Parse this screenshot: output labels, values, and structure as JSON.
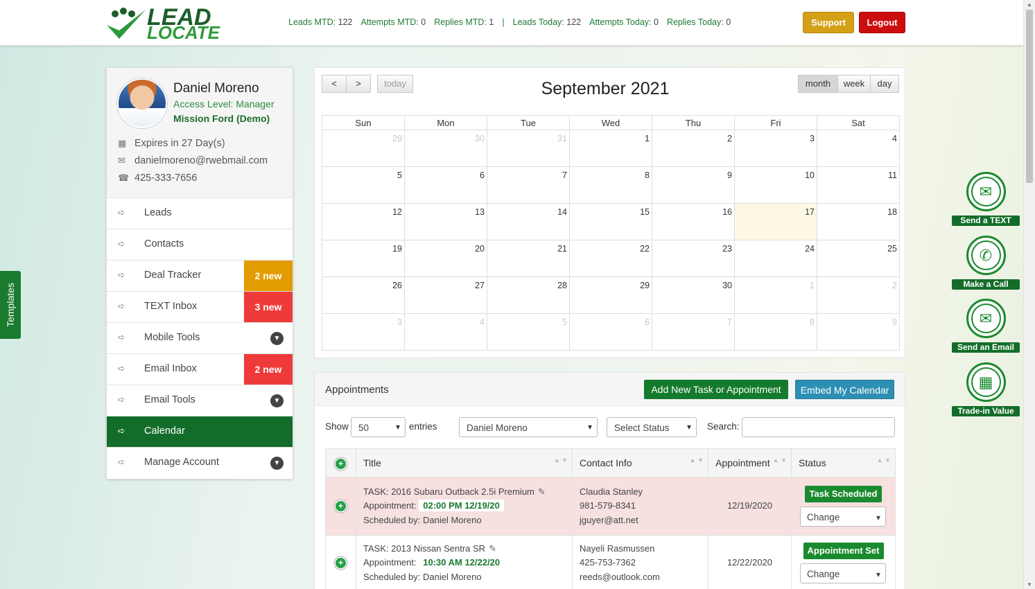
{
  "header": {
    "logo_line1": "LEAD",
    "logo_line2": "LOCATE",
    "stats": [
      {
        "label": "Leads MTD:",
        "value": "122"
      },
      {
        "label": "Attempts MTD:",
        "value": "0"
      },
      {
        "label": "Replies MTD:",
        "value": "1"
      },
      {
        "label": "|",
        "value": ""
      },
      {
        "label": "Leads Today:",
        "value": "122"
      },
      {
        "label": "Attempts Today:",
        "value": "0"
      },
      {
        "label": "Replies Today:",
        "value": "0"
      }
    ],
    "support_label": "Support",
    "logout_label": "Logout"
  },
  "templates_tab": "Templates",
  "profile": {
    "name": "Daniel Moreno",
    "access_level": "Access Level: Manager",
    "dealership": "Mission Ford (Demo)",
    "expires": "Expires in 27 Day(s)",
    "email": "danielmoreno@rwebmail.com",
    "phone": "425-333-7656"
  },
  "nav": [
    {
      "label": "Leads",
      "badge": "",
      "chevron": false,
      "active": false
    },
    {
      "label": "Contacts",
      "badge": "",
      "chevron": false,
      "active": false
    },
    {
      "label": "Deal Tracker",
      "badge": "2 new",
      "badge_color": "#e39c00",
      "chevron": false,
      "active": false
    },
    {
      "label": "TEXT Inbox",
      "badge": "3 new",
      "badge_color": "#ef3a3a",
      "chevron": false,
      "active": false
    },
    {
      "label": "Mobile Tools",
      "badge": "",
      "chevron": true,
      "active": false
    },
    {
      "label": "Email Inbox",
      "badge": "2 new",
      "badge_color": "#ef3a3a",
      "chevron": false,
      "active": false
    },
    {
      "label": "Email Tools",
      "badge": "",
      "chevron": true,
      "active": false
    },
    {
      "label": "Calendar",
      "badge": "",
      "chevron": false,
      "active": true
    },
    {
      "label": "Manage Account",
      "badge": "",
      "chevron": true,
      "active": false
    }
  ],
  "calendar": {
    "prev_label": "<",
    "next_label": ">",
    "today_label": "today",
    "title": "September 2021",
    "views": [
      "month",
      "week",
      "day"
    ],
    "active_view": "month",
    "weekdays": [
      "Sun",
      "Mon",
      "Tue",
      "Wed",
      "Thu",
      "Fri",
      "Sat"
    ],
    "weeks": [
      [
        "29",
        "30",
        "31",
        "1",
        "2",
        "3",
        "4"
      ],
      [
        "5",
        "6",
        "7",
        "8",
        "9",
        "10",
        "11"
      ],
      [
        "12",
        "13",
        "14",
        "15",
        "16",
        "17",
        "18"
      ],
      [
        "19",
        "20",
        "21",
        "22",
        "23",
        "24",
        "25"
      ],
      [
        "26",
        "27",
        "28",
        "29",
        "30",
        "1",
        "2"
      ],
      [
        "3",
        "4",
        "5",
        "6",
        "7",
        "8",
        "9"
      ]
    ],
    "today": "17"
  },
  "appointments": {
    "title": "Appointments",
    "add_label": "Add New Task or Appointment",
    "embed_label": "Embed My Calendar",
    "show_label": "Show",
    "entries_value": "50",
    "entries_label": "entries",
    "user_filter": "Daniel Moreno",
    "status_filter": "Select Status",
    "search_label": "Search:",
    "search_value": "",
    "columns": [
      "Title",
      "Contact Info",
      "Appointment",
      "Status"
    ],
    "rows": [
      {
        "title": "TASK: 2016 Subaru Outback 2.5i Premium",
        "appt_label": "Appointment:",
        "appt_time": "02:00 PM 12/19/20",
        "scheduled": "Scheduled by: Daniel Moreno",
        "contact_name": "Claudia Stanley",
        "contact_phone": "981-579-8341",
        "contact_email": "jguyer@att.net",
        "date": "12/19/2020",
        "status": "Task Scheduled",
        "change": "Change"
      },
      {
        "title": "TASK: 2013 Nissan Sentra SR",
        "appt_label": "Appointment:",
        "appt_time": "10:30 AM 12/22/20",
        "scheduled": "Scheduled by: Daniel Moreno",
        "contact_name": "Nayeli Rasmussen",
        "contact_phone": "425-753-7362",
        "contact_email": "reeds@outlook.com",
        "date": "12/22/2020",
        "status": "Appointment Set",
        "change": "Change"
      }
    ]
  },
  "actions": [
    {
      "label": "Send a TEXT",
      "icon": "chat-icon"
    },
    {
      "label": "Make a Call",
      "icon": "phone-icon"
    },
    {
      "label": "Send an Email",
      "icon": "envelope-icon"
    },
    {
      "label": "Trade-in Value",
      "icon": "calculator-icon"
    }
  ],
  "colors": {
    "brand_green": "#136d2a",
    "accent_green": "#1a8a2e",
    "badge_orange": "#e39c00",
    "badge_red": "#ef3a3a",
    "support_gold": "#d4a017",
    "logout_red": "#cc0d0d"
  }
}
